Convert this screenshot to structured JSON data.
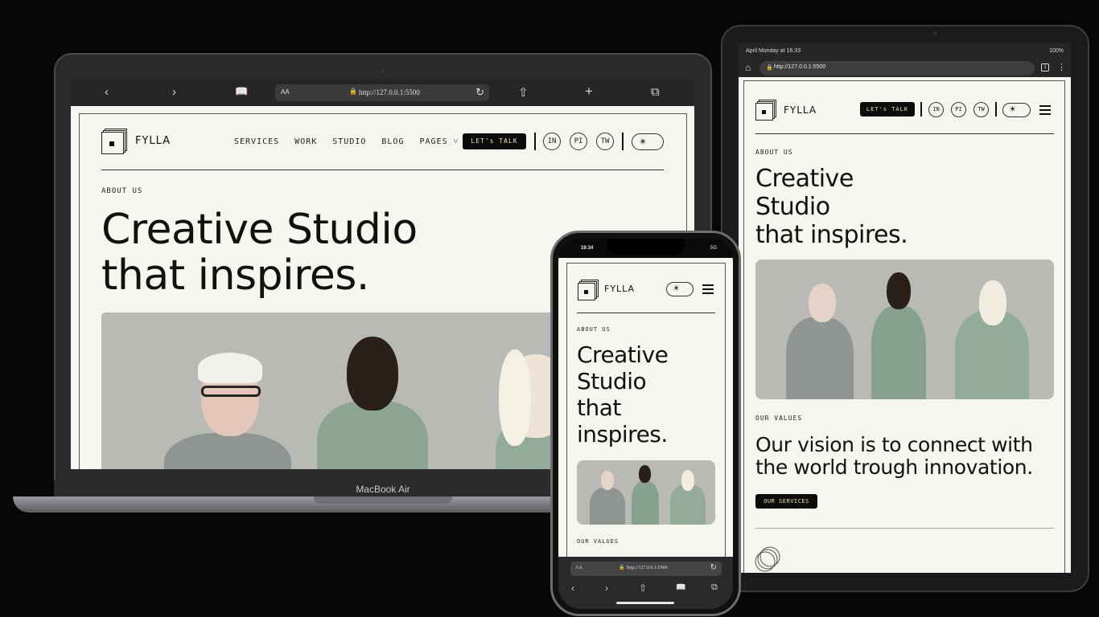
{
  "site": {
    "brand": "FYLLA",
    "nav": [
      "SERVICES",
      "WORK",
      "STUDIO",
      "BLOG",
      "PAGES"
    ],
    "cta": "LET's TALK",
    "socials": [
      "IN",
      "PI",
      "TW"
    ],
    "kicker": "ABOUT US",
    "headline_laptop": [
      "Creative Studio",
      "that inspires."
    ],
    "headline_tablet": [
      "Creative",
      "Studio",
      "that inspires."
    ],
    "headline_phone": [
      "Creative",
      "Studio",
      "that",
      "inspires."
    ],
    "values_kicker": "OUR VALUES",
    "vision": [
      "Our vision is to connect with",
      "the world trough innovation."
    ],
    "services_button": "OUR SERVICES",
    "theme_icon": "sun-icon",
    "menu_icon": "hamburger-icon"
  },
  "laptop": {
    "model": "MacBook Air",
    "url_aa": "AA",
    "url": "http://127.0.0.1:5500",
    "icons": [
      "back-icon",
      "forward-icon",
      "book-icon",
      "share-icon",
      "new-tab-icon",
      "tabs-icon"
    ]
  },
  "tablet": {
    "status_left": "April Monday at 16:33",
    "status_right": "100%",
    "url": "http://127.0.0.1:5500"
  },
  "phone": {
    "time": "16:34",
    "status_right": "5G",
    "url_aa": "AA",
    "url": "http://127.0.0.1:5500"
  }
}
